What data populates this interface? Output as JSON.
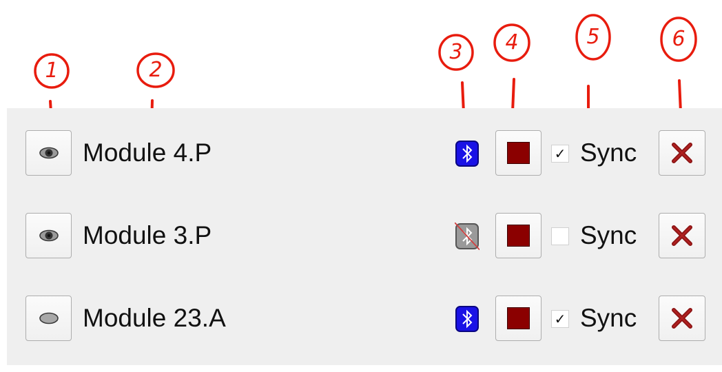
{
  "annotations": [
    "1",
    "2",
    "3",
    "4",
    "5",
    "6"
  ],
  "colors": {
    "annotation": "#e81c0e",
    "panel_bg": "#efefef",
    "bt_enabled": "#1a12e6",
    "bt_disabled": "#9a9a9a",
    "swatch": "#8b0000",
    "remove_x": "#8b1414"
  },
  "modules": [
    {
      "name": "Module 4.P",
      "visibility_icon": "eye-open-icon",
      "bluetooth": "enabled",
      "color": "#8b0000",
      "sync_checked": true,
      "sync_label": "Sync",
      "check_mark": "✓"
    },
    {
      "name": "Module 3.P",
      "visibility_icon": "eye-open-icon",
      "bluetooth": "disabled",
      "color": "#8b0000",
      "sync_checked": false,
      "sync_label": "Sync",
      "check_mark": ""
    },
    {
      "name": "Module 23.A",
      "visibility_icon": "eye-closed-icon",
      "bluetooth": "enabled",
      "color": "#8b0000",
      "sync_checked": true,
      "sync_label": "Sync",
      "check_mark": "✓"
    }
  ]
}
